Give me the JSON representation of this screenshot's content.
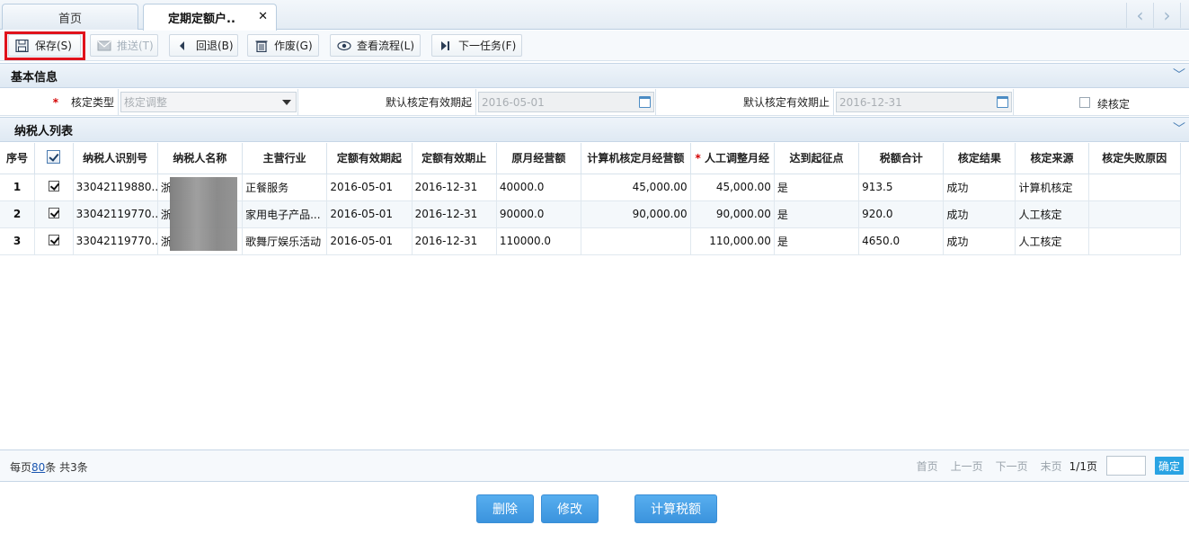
{
  "tabs": [
    {
      "label": "首页"
    },
    {
      "label": "定期定额户.."
    }
  ],
  "toolbar": {
    "save": "保存(S)",
    "push": "推送(T)",
    "back": "回退(B)",
    "void": "作废(G)",
    "flow": "查看流程(L)",
    "next": "下一任务(F)"
  },
  "basic_info": {
    "title": "基本信息",
    "type_label": "核定类型",
    "type_value": "核定调整",
    "start_label": "默认核定有效期起",
    "start_value": "2016-05-01",
    "end_label": "默认核定有效期止",
    "end_value": "2016-12-31",
    "continue_label": "续核定"
  },
  "taxpayer_list": {
    "title": "纳税人列表",
    "columns": [
      "序号",
      "",
      "纳税人识别号",
      "纳税人名称",
      "主营行业",
      "定额有效期起",
      "定额有效期止",
      "原月经营额",
      "计算机核定月经营额",
      "人工调整月经",
      "达到起征点",
      "税额合计",
      "核定结果",
      "核定来源",
      "核定失败原因"
    ],
    "rows": [
      {
        "idx": "1",
        "id": "33042119880...",
        "name": "浙",
        "industry": "正餐服务",
        "start": "2016-05-01",
        "end": "2016-12-31",
        "orig": "40000.0",
        "computer": "45,000.00",
        "manual": "45,000.00",
        "threshold": "是",
        "tax": "913.5",
        "result": "成功",
        "source": "计算机核定",
        "fail": ""
      },
      {
        "idx": "2",
        "id": "33042119770...",
        "name": "浙",
        "industry": "家用电子产品...",
        "start": "2016-05-01",
        "end": "2016-12-31",
        "orig": "90000.0",
        "computer": "90,000.00",
        "manual": "90,000.00",
        "threshold": "是",
        "tax": "920.0",
        "result": "成功",
        "source": "人工核定",
        "fail": ""
      },
      {
        "idx": "3",
        "id": "33042119770...",
        "name": "浙",
        "industry": "歌舞厅娱乐活动",
        "start": "2016-05-01",
        "end": "2016-12-31",
        "orig": "110000.0",
        "computer": "",
        "manual": "110,000.00",
        "threshold": "是",
        "tax": "4650.0",
        "result": "成功",
        "source": "人工核定",
        "fail": ""
      }
    ]
  },
  "pager": {
    "per_page_prefix": "每页",
    "per_page": "80",
    "per_page_suffix": "条 共3条",
    "first": "首页",
    "prev": "上一页",
    "next": "下一页",
    "last": "末页",
    "page_info": "1/1页",
    "confirm": "确定"
  },
  "actions": {
    "delete": "删除",
    "modify": "修改",
    "calc": "计算税额"
  },
  "colors": {
    "highlight": "#e0121b",
    "button_blue": "#3b93dd"
  }
}
